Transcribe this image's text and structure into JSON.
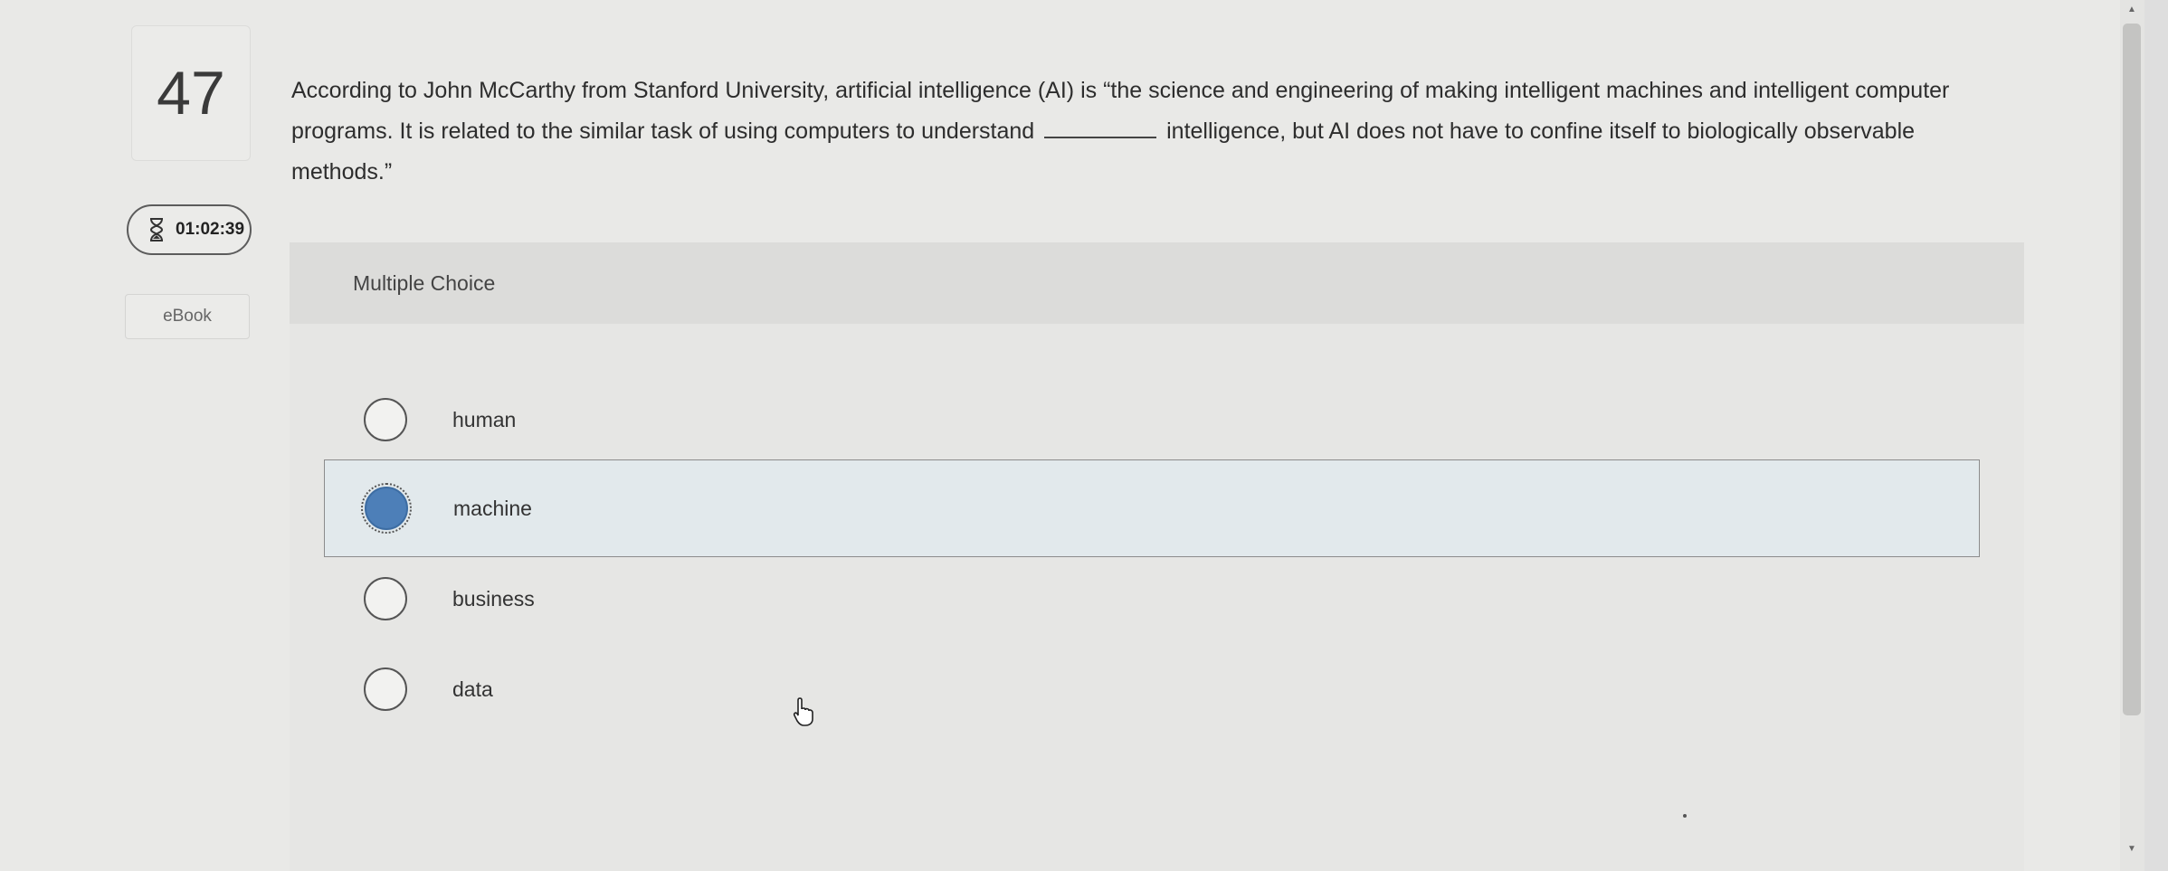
{
  "question": {
    "number": "47",
    "text_before": "According to John McCarthy from Stanford University, artificial intelligence (AI) is “the science and engineering of making intelligent machines and intelligent computer programs. It is related to the similar task of using computers to understand",
    "text_after": "intelligence, but AI does not have to confine itself to biologically observable methods.”"
  },
  "timer": {
    "value": "01:02:39",
    "icon": "hourglass-icon"
  },
  "ebook": {
    "label": "eBook"
  },
  "panel": {
    "heading": "Multiple Choice"
  },
  "options": [
    {
      "label": "human",
      "selected": false
    },
    {
      "label": "machine",
      "selected": true
    },
    {
      "label": "business",
      "selected": false
    },
    {
      "label": "data",
      "selected": false
    }
  ],
  "colors": {
    "selected_radio": "#4d7fb8",
    "selected_bg": "#e2e9ec"
  }
}
